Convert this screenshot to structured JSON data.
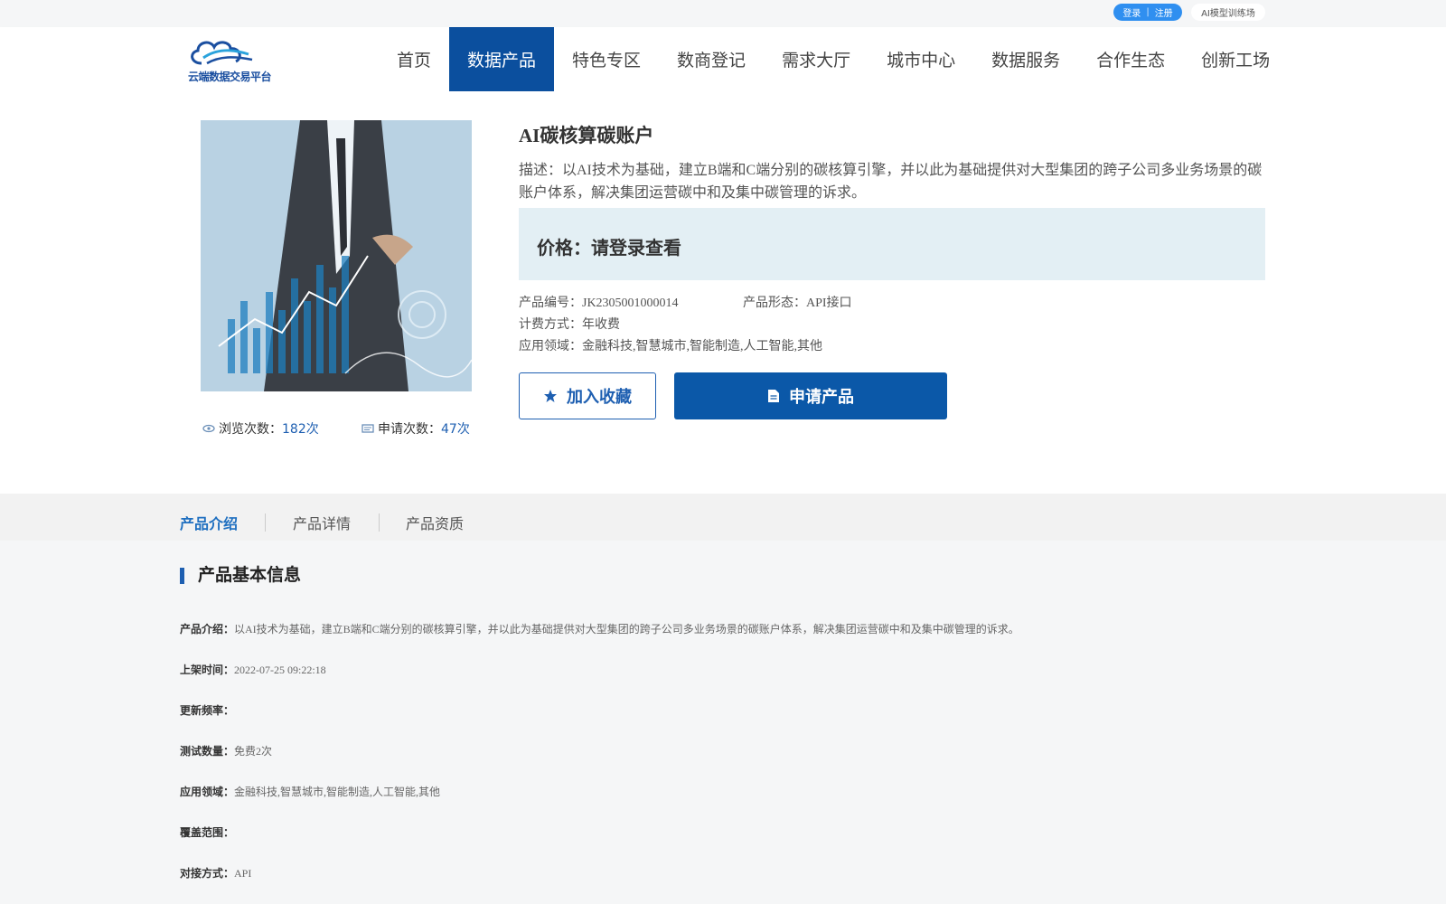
{
  "topbar": {
    "login_label": "登录",
    "separator": "|",
    "register_label": "注册",
    "ai_training_label": "AI模型训练场"
  },
  "header": {
    "logo_text": "云端数据交易平台",
    "nav": [
      {
        "label": "首页",
        "active": false
      },
      {
        "label": "数据产品",
        "active": true
      },
      {
        "label": "特色专区",
        "active": false
      },
      {
        "label": "数商登记",
        "active": false
      },
      {
        "label": "需求大厅",
        "active": false
      },
      {
        "label": "城市中心",
        "active": false
      },
      {
        "label": "数据服务",
        "active": false
      },
      {
        "label": "合作生态",
        "active": false
      },
      {
        "label": "创新工场",
        "active": false
      }
    ]
  },
  "product": {
    "title": "AI碳核算碳账户",
    "description": "描述：以AI技术为基础，建立B端和C端分别的碳核算引擎，并以此为基础提供对大型集团的跨子公司多业务场景的碳账户体系，解决集团运营碳中和及集中碳管理的诉求。",
    "price_text": "价格：请登录查看",
    "code": "产品编号：JK2305001000014",
    "form": "产品形态：API接口",
    "billing": "计费方式：年收费",
    "domain": "应用领域：金融科技,智慧城市,智能制造,人工智能,其他",
    "favorite_label": "加入收藏",
    "apply_label": "申请产品",
    "views_label": "浏览次数：",
    "views_value": "182次",
    "applies_label": "申请次数：",
    "applies_value": "47次"
  },
  "tabs": [
    {
      "label": "产品介绍",
      "active": true
    },
    {
      "label": "产品详情",
      "active": false
    },
    {
      "label": "产品资质",
      "active": false
    }
  ],
  "info": {
    "section_title": "产品基本信息",
    "rows": [
      {
        "key": "产品介绍：",
        "value": "以AI技术为基础，建立B端和C端分别的碳核算引擎，并以此为基础提供对大型集团的跨子公司多业务场景的碳账户体系，解决集团运营碳中和及集中碳管理的诉求。"
      },
      {
        "key": "上架时间：",
        "value": "2022-07-25 09:22:18"
      },
      {
        "key": "更新频率：",
        "value": ""
      },
      {
        "key": "测试数量：",
        "value": "免费2次"
      },
      {
        "key": "应用领域：",
        "value": "金融科技,智慧城市,智能制造,人工智能,其他"
      },
      {
        "key": "覆盖范围：",
        "value": ""
      },
      {
        "key": "对接方式：",
        "value": "API"
      }
    ]
  },
  "colors": {
    "brand_blue": "#0b4f9e",
    "accent_blue": "#1e5fb1",
    "price_bg": "#e3eff4"
  }
}
